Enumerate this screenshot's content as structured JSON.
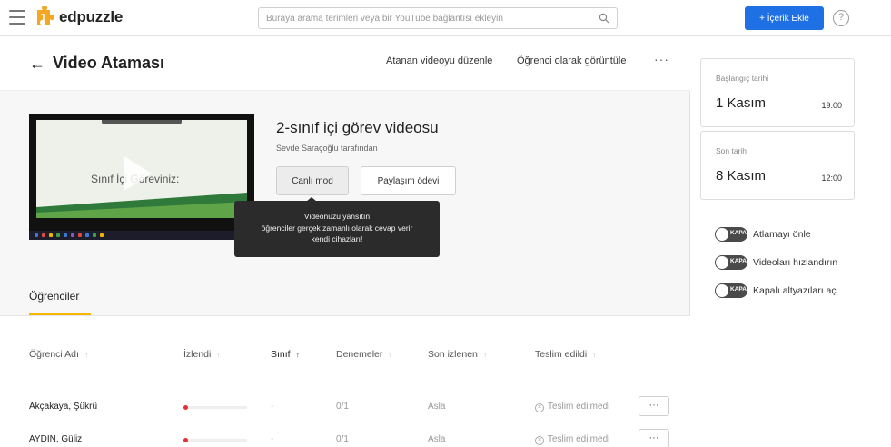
{
  "topbar": {
    "brand": "edpuzzle",
    "search_placeholder": "Buraya arama terimleri veya bir YouTube bağlantısı ekleyin",
    "add_button": "+ İçerik Ekle",
    "help": "?"
  },
  "header": {
    "title": "Video Ataması",
    "edit_link": "Atanan videoyu düzenle",
    "student_view_link": "Öğrenci olarak görüntüle",
    "more": "···"
  },
  "video": {
    "slide_text": "Sınıf İçi Göreviniz:",
    "title": "2-sınıf içi görev videosu",
    "author": "Sevde Saraçoğlu tarafından",
    "live_button": "Canlı mod",
    "share_button": "Paylaşım ödevi",
    "tooltip_line1": "Videonuzu yansıtın",
    "tooltip_line2": "öğrenciler gerçek zamanlı olarak cevap verir",
    "tooltip_line3": "kendi cihazları!"
  },
  "tabs": {
    "students": "Öğrenciler"
  },
  "table": {
    "columns": [
      {
        "label": "Öğrenci Adı",
        "arrow": "↑"
      },
      {
        "label": "İzlendi",
        "arrow": "↑"
      },
      {
        "label": "Sınıf",
        "arrow": "↑"
      },
      {
        "label": "Denemeler",
        "arrow": "↑"
      },
      {
        "label": "Son izlenen",
        "arrow": "↑"
      },
      {
        "label": "Teslim edildi",
        "arrow": "↑"
      }
    ],
    "rows": [
      {
        "name": "Akçakaya, Şükrü",
        "watched": 0.0,
        "class": "-",
        "tries": "0/1",
        "last": "Asla",
        "submitted": "Teslim edilmedi",
        "more": "···"
      },
      {
        "name": "AYDIN, Güliz",
        "watched": 0.0,
        "class": "-",
        "tries": "0/1",
        "last": "Asla",
        "submitted": "Teslim edilmedi",
        "more": "···"
      }
    ]
  },
  "sidebar": {
    "start": {
      "label": "Başlangıç tarihi",
      "date": "1 Kasım",
      "time": "19:00"
    },
    "due": {
      "label": "Son tarih",
      "date": "8 Kasım",
      "time": "12:00"
    },
    "toggles": [
      {
        "state": "KAPALI",
        "label": "Atlamayı önle"
      },
      {
        "state": "KAPALI",
        "label": "Videoları hızlandırın"
      },
      {
        "state": "KAPALI",
        "label": "Kapalı altyazıları aç"
      }
    ]
  },
  "colors": {
    "primary": "#1f6fe5",
    "tab_accent": "#f5b800",
    "progress_dot": "#e0303a",
    "tooltip_bg": "#2b2b2b",
    "logo_orange": "#f5a623"
  }
}
